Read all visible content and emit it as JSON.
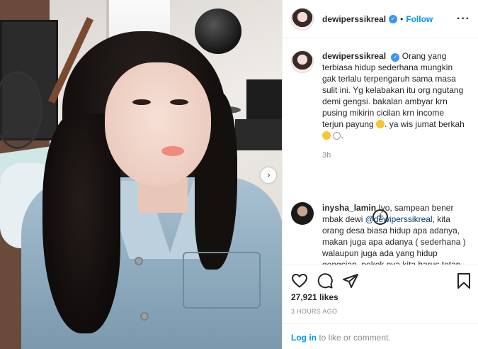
{
  "post": {
    "username": "dewiperssikreal",
    "follow_label": "Follow",
    "separator": "•",
    "more_label": "···"
  },
  "caption": {
    "username": "dewiperssikreal",
    "text": "Orang yang terbiasa hidup sederhana mungkin gak terlalu terpengaruh sama masa sulit ini. Yg kelabakan itu org ngutang demi gengsi. bakalan ambyar krn pusing mikirin cicilan krn income terjun payung",
    "text_tail": ". ya wis jumat berkah",
    "time": "3h"
  },
  "comment1": {
    "username": "inysha_lamin",
    "text_before": "Iyo, sampean bener mbak dewi",
    "mention": "@dewiperssikreal",
    "text_after": ", kita orang desa biasa hidup apa adanya, makan juga apa adanya ( sederhana ) walaupun juga ada yang hidup gengsian, pokok nya kita harus tetap"
  },
  "load_more_label": "+",
  "actions": {
    "likes": "27,921 likes",
    "timestamp": "3 HOURS AGO"
  },
  "login": {
    "link": "Log in",
    "text": " to like or comment."
  },
  "carousel_next": "›",
  "icons": {
    "verified": "verified-badge-icon",
    "like": "heart-icon",
    "comment": "comment-icon",
    "share": "paper-plane-icon",
    "save": "bookmark-icon"
  },
  "colors": {
    "accent": "#0095f6",
    "verified": "#3897f0",
    "muted": "#8e8e8e"
  }
}
